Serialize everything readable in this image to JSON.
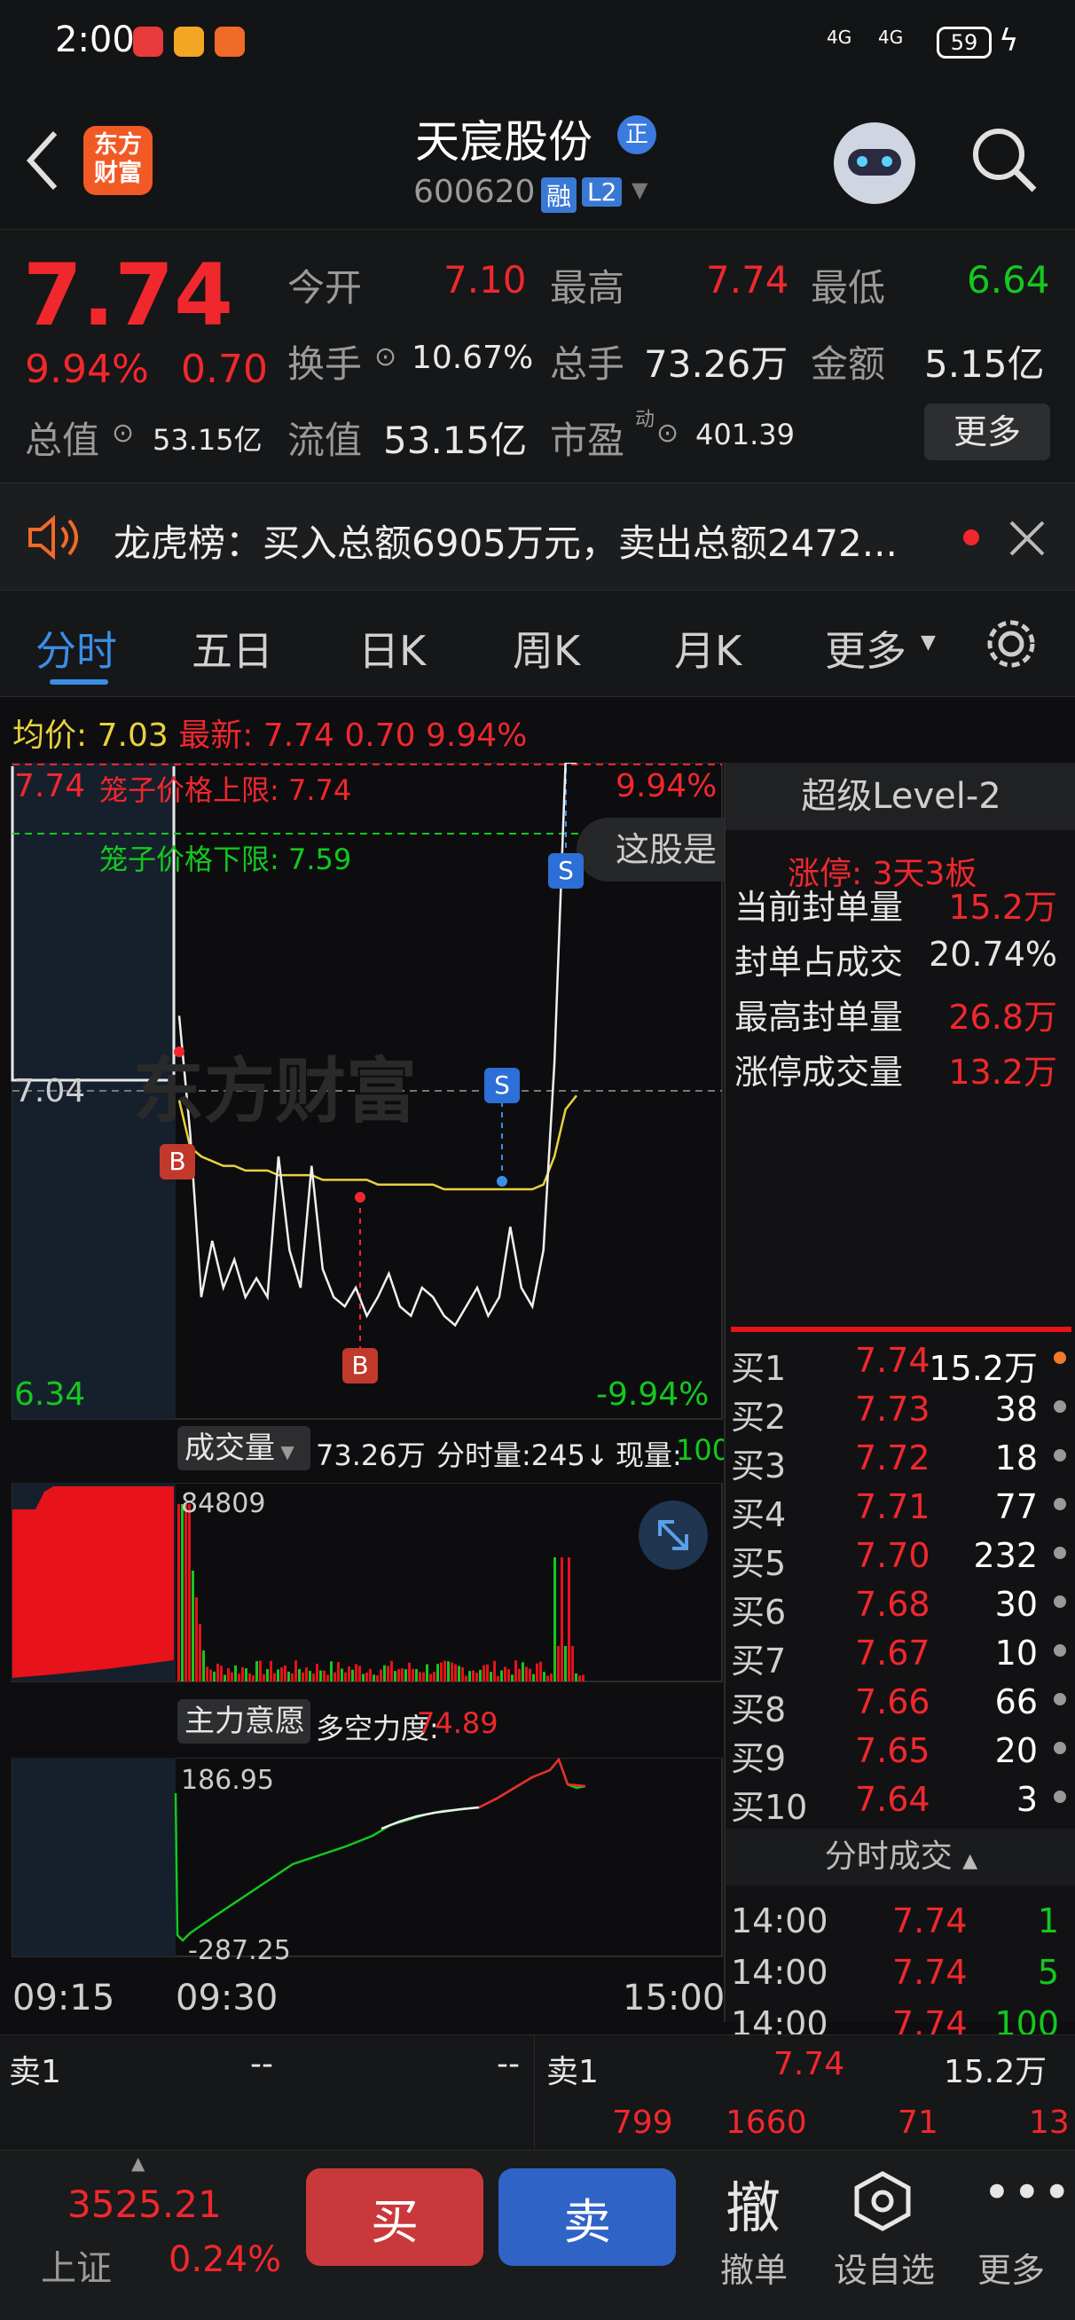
{
  "status_bar": {
    "time": "2:00",
    "signal1": "4G",
    "signal2": "4G",
    "battery": "59"
  },
  "header": {
    "logo_line1": "东方",
    "logo_line2": "财富",
    "stock_name": "天宸股份",
    "badge": "正",
    "code": "600620",
    "tag_rong": "融",
    "tag_l2": "L2"
  },
  "quote": {
    "price": "7.74",
    "change_pct": "9.94%",
    "change": "0.70",
    "open_label": "今开",
    "open": "7.10",
    "high_label": "最高",
    "high": "7.74",
    "low_label": "最低",
    "low": "6.64",
    "turnover_label": "换手",
    "turnover": "10.67%",
    "volume_label": "总手",
    "volume": "73.26万",
    "amount_label": "金额",
    "amount": "5.15亿",
    "mktcap_label": "总值",
    "mktcap": "53.15亿",
    "float_label": "流值",
    "float": "53.15亿",
    "pe_label": "市盈",
    "pe_sup": "动",
    "pe": "401.39",
    "more_button": "更多"
  },
  "news": {
    "text": "龙虎榜：买入总额6905万元，卖出总额2472..."
  },
  "tabs": [
    "分时",
    "五日",
    "日K",
    "周K",
    "月K",
    "更多"
  ],
  "avg_bar": {
    "avg_label": "均价:",
    "avg": "7.03",
    "last_label": "最新:",
    "last": "7.74",
    "chg": "0.70",
    "pct": "9.94%"
  },
  "chart": {
    "y_top": "7.74",
    "y_mid": "7.04",
    "y_bot": "6.34",
    "pct_top": "9.94%",
    "pct_bot": "-9.94%",
    "cage_upper": "笼子价格上限: 7.74",
    "cage_lower": "笼子价格下限: 7.59",
    "tooltip": "这股是",
    "marker_b": "B",
    "marker_s": "S",
    "watermark": "东方财富"
  },
  "chart_data": {
    "type": "line",
    "x_ticks": [
      "09:15",
      "09:30",
      "15:00"
    ],
    "ylim": [
      6.34,
      7.74
    ],
    "price_series": [
      7.2,
      6.95,
      6.6,
      6.72,
      6.62,
      6.68,
      6.6,
      6.64,
      6.6,
      6.9,
      6.7,
      6.62,
      6.88,
      6.66,
      6.6,
      6.58,
      6.62,
      6.56,
      6.6,
      6.65,
      6.58,
      6.56,
      6.62,
      6.6,
      6.56,
      6.54,
      6.58,
      6.62,
      6.56,
      6.6,
      6.75,
      6.62,
      6.58,
      6.7,
      7.1,
      7.74,
      7.74
    ],
    "avg_series": [
      7.02,
      6.92,
      6.9,
      6.89,
      6.88,
      6.88,
      6.87,
      6.87,
      6.87,
      6.86,
      6.86,
      6.86,
      6.86,
      6.85,
      6.85,
      6.85,
      6.85,
      6.85,
      6.84,
      6.84,
      6.84,
      6.84,
      6.84,
      6.84,
      6.83,
      6.83,
      6.83,
      6.83,
      6.83,
      6.83,
      6.83,
      6.83,
      6.83,
      6.84,
      6.9,
      7.0,
      7.03
    ]
  },
  "volume_panel": {
    "label": "成交量",
    "total": "73.26万",
    "tick": "分时量:245↓",
    "cur_label": "现量:",
    "cur": "100",
    "max": "84809"
  },
  "power_panel": {
    "label": "主力意愿",
    "power_label": "多空力度:",
    "power": "74.89",
    "max": "186.95",
    "min": "-287.25"
  },
  "time_axis": [
    "09:15",
    "09:30",
    "15:00"
  ],
  "level2": {
    "title": "超级Level-2",
    "limit_up": "涨停: 3天3板",
    "stats": [
      {
        "label": "当前封单量",
        "value": "15.2万"
      },
      {
        "label": "封单占成交",
        "value": "20.74%"
      },
      {
        "label": "最高封单量",
        "value": "26.8万"
      },
      {
        "label": "涨停成交量",
        "value": "13.2万"
      }
    ],
    "bids": [
      {
        "label": "买1",
        "price": "7.74",
        "qty": "15.2万"
      },
      {
        "label": "买2",
        "price": "7.73",
        "qty": "38"
      },
      {
        "label": "买3",
        "price": "7.72",
        "qty": "18"
      },
      {
        "label": "买4",
        "price": "7.71",
        "qty": "77"
      },
      {
        "label": "买5",
        "price": "7.70",
        "qty": "232"
      },
      {
        "label": "买6",
        "price": "7.68",
        "qty": "30"
      },
      {
        "label": "买7",
        "price": "7.67",
        "qty": "10"
      },
      {
        "label": "买8",
        "price": "7.66",
        "qty": "66"
      },
      {
        "label": "买9",
        "price": "7.65",
        "qty": "20"
      },
      {
        "label": "买10",
        "price": "7.64",
        "qty": "3"
      }
    ],
    "trades_title": "分时成交",
    "trades": [
      {
        "time": "14:00",
        "price": "7.74",
        "qty": "1"
      },
      {
        "time": "14:00",
        "price": "7.74",
        "qty": "5"
      },
      {
        "time": "14:00",
        "price": "7.74",
        "qty": "100"
      }
    ]
  },
  "order_strip": {
    "sell1_label": "卖1",
    "sell1_a": "--",
    "sell1_b": "--",
    "buy1_label": "卖1",
    "buy1_price": "7.74",
    "buy1_qty": "15.2万",
    "q1": "799",
    "q2": "1660",
    "q3": "71",
    "q4": "13"
  },
  "bottom": {
    "index_value": "3525.21",
    "index_name": "上证",
    "index_pct": "0.24%",
    "buy": "买",
    "sell": "卖",
    "cancel_icon": "撤",
    "cancel": "撤单",
    "watch": "设自选",
    "more": "更多"
  }
}
